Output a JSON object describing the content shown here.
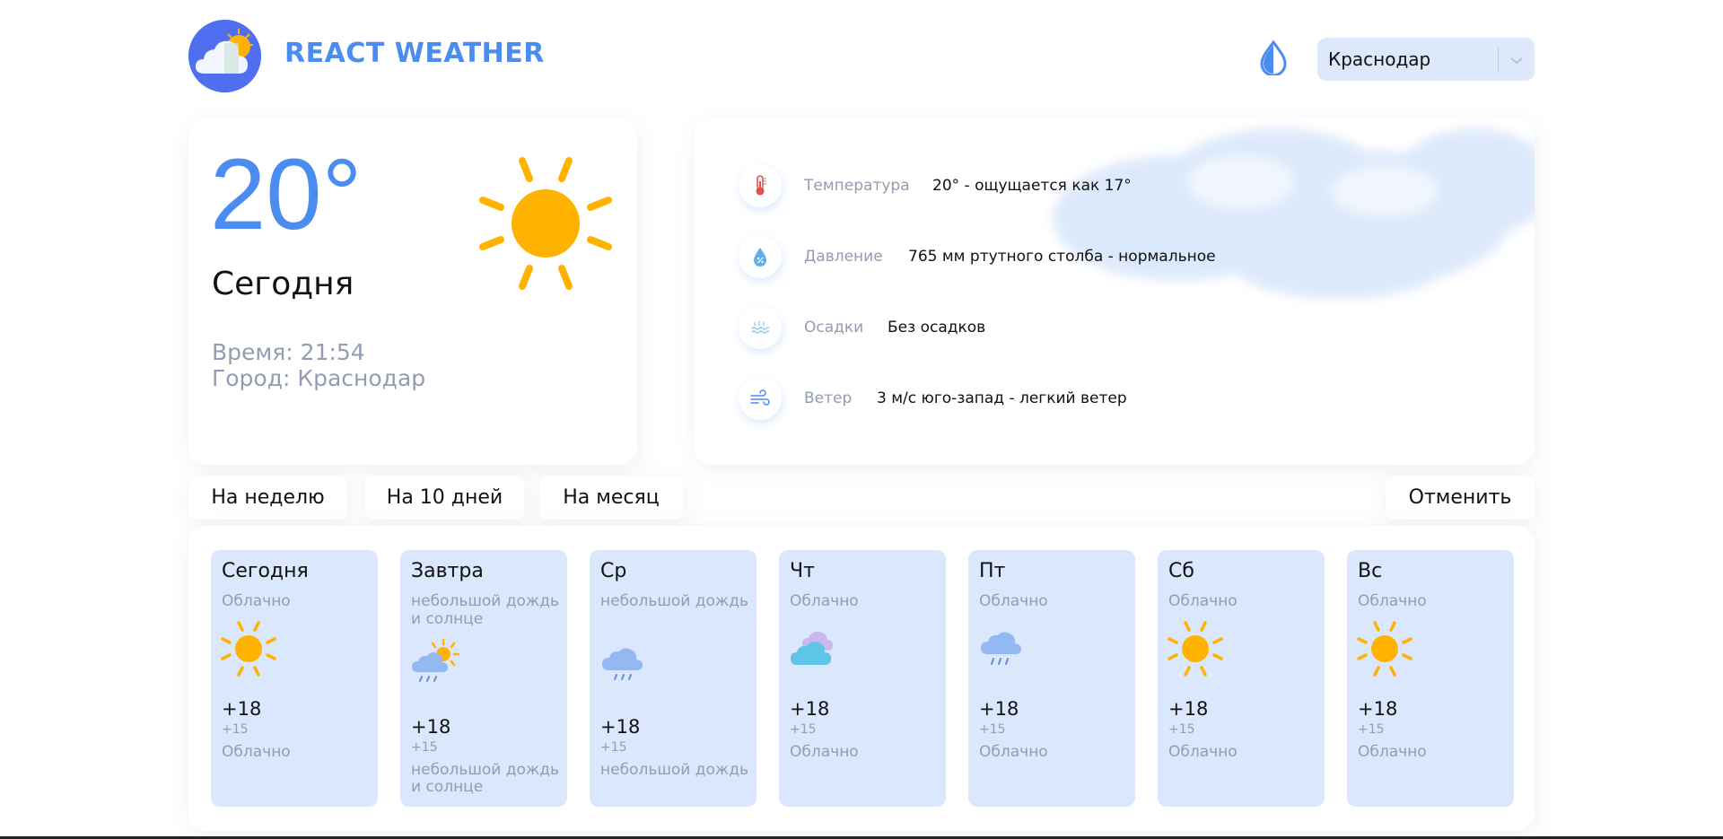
{
  "header": {
    "title": "REACT WEATHER",
    "logo_icon": "cloud-sun-logo-icon",
    "theme_icon": "drop-icon",
    "city_select": {
      "value": "Краснодар"
    }
  },
  "today": {
    "temperature": "20°",
    "day": "Сегодня",
    "time": "Время: 21:54",
    "city": "Город: Краснодар",
    "icon": "sun-icon"
  },
  "details": [
    {
      "icon": "thermometer-icon",
      "label": "Температура",
      "value": "20° - ощущается как 17°"
    },
    {
      "icon": "pressure-icon",
      "label": "Давление",
      "value": "765 мм ртутного столба - нормальное"
    },
    {
      "icon": "precipitation-icon",
      "label": "Осадки",
      "value": "Без осадков"
    },
    {
      "icon": "wind-icon",
      "label": "Ветер",
      "value": "3 м/с юго-запад - легкий ветер"
    }
  ],
  "tabs": {
    "week": "На неделю",
    "ten_days": "На 10 дней",
    "month": "На месяц",
    "cancel": "Отменить"
  },
  "forecast": [
    {
      "day": "Сегодня",
      "desc": "Облачно",
      "icon": "sun-icon",
      "temp": "+18",
      "night": "+15",
      "bottom": "Облачно"
    },
    {
      "day": "Завтра",
      "desc": "небольшой дождь и солнце",
      "icon": "sun-rain-icon",
      "temp": "+18",
      "night": "+15",
      "bottom": "небольшой дождь и солнце"
    },
    {
      "day": "Ср",
      "desc": "небольшой дождь",
      "icon": "rain-icon",
      "temp": "+18",
      "night": "+15",
      "bottom": "небольшой дождь"
    },
    {
      "day": "Чт",
      "desc": "Облачно",
      "icon": "cloudy-icon",
      "temp": "+18",
      "night": "+15",
      "bottom": "Облачно"
    },
    {
      "day": "Пт",
      "desc": "Облачно",
      "icon": "rain-icon",
      "temp": "+18",
      "night": "+15",
      "bottom": "Облачно"
    },
    {
      "day": "Сб",
      "desc": "Облачно",
      "icon": "sun-icon",
      "temp": "+18",
      "night": "+15",
      "bottom": "Облачно"
    },
    {
      "day": "Вс",
      "desc": "Облачно",
      "icon": "sun-icon",
      "temp": "+18",
      "night": "+15",
      "bottom": "Облачно"
    }
  ],
  "colors": {
    "accent": "#4a8cf0",
    "card_bg": "#dbe7fc",
    "muted_text": "#939cb0",
    "sun": "#ffb300"
  }
}
